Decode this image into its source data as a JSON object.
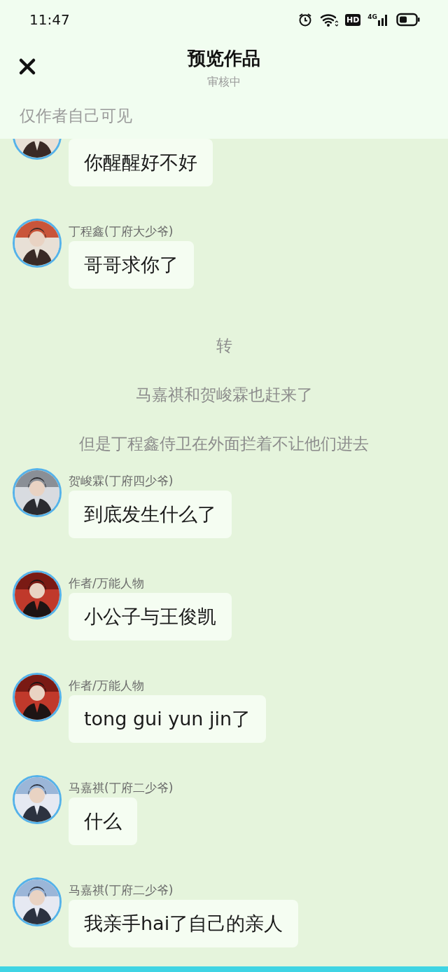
{
  "status_bar": {
    "time": "11:47",
    "hd": "HD",
    "network": "4G"
  },
  "header": {
    "title": "预览作品",
    "subtitle": "审核中",
    "notice": "仅作者自己可见"
  },
  "messages": [
    {
      "kind": "message",
      "text": "你醒醒好不好"
    },
    {
      "kind": "message",
      "name": "丁程鑫(丁府大少爷)",
      "text": "哥哥求你了"
    },
    {
      "kind": "narration",
      "text": "转"
    },
    {
      "kind": "narration",
      "text": "马嘉祺和贺峻霖也赶来了"
    },
    {
      "kind": "narration",
      "text": "但是丁程鑫侍卫在外面拦着不让他们进去"
    },
    {
      "kind": "message",
      "name": "贺峻霖(丁府四少爷)",
      "text": "到底发生什么了"
    },
    {
      "kind": "message",
      "name": "作者/万能人物",
      "text": "小公子与王俊凯"
    },
    {
      "kind": "message",
      "name": "作者/万能人物",
      "text": "tong gui yun jin了"
    },
    {
      "kind": "message",
      "name": "马嘉祺(丁府二少爷)",
      "text": "什么"
    },
    {
      "kind": "message",
      "name": "马嘉祺(丁府二少爷)",
      "text": "我亲手hai了自己的亲人"
    }
  ]
}
